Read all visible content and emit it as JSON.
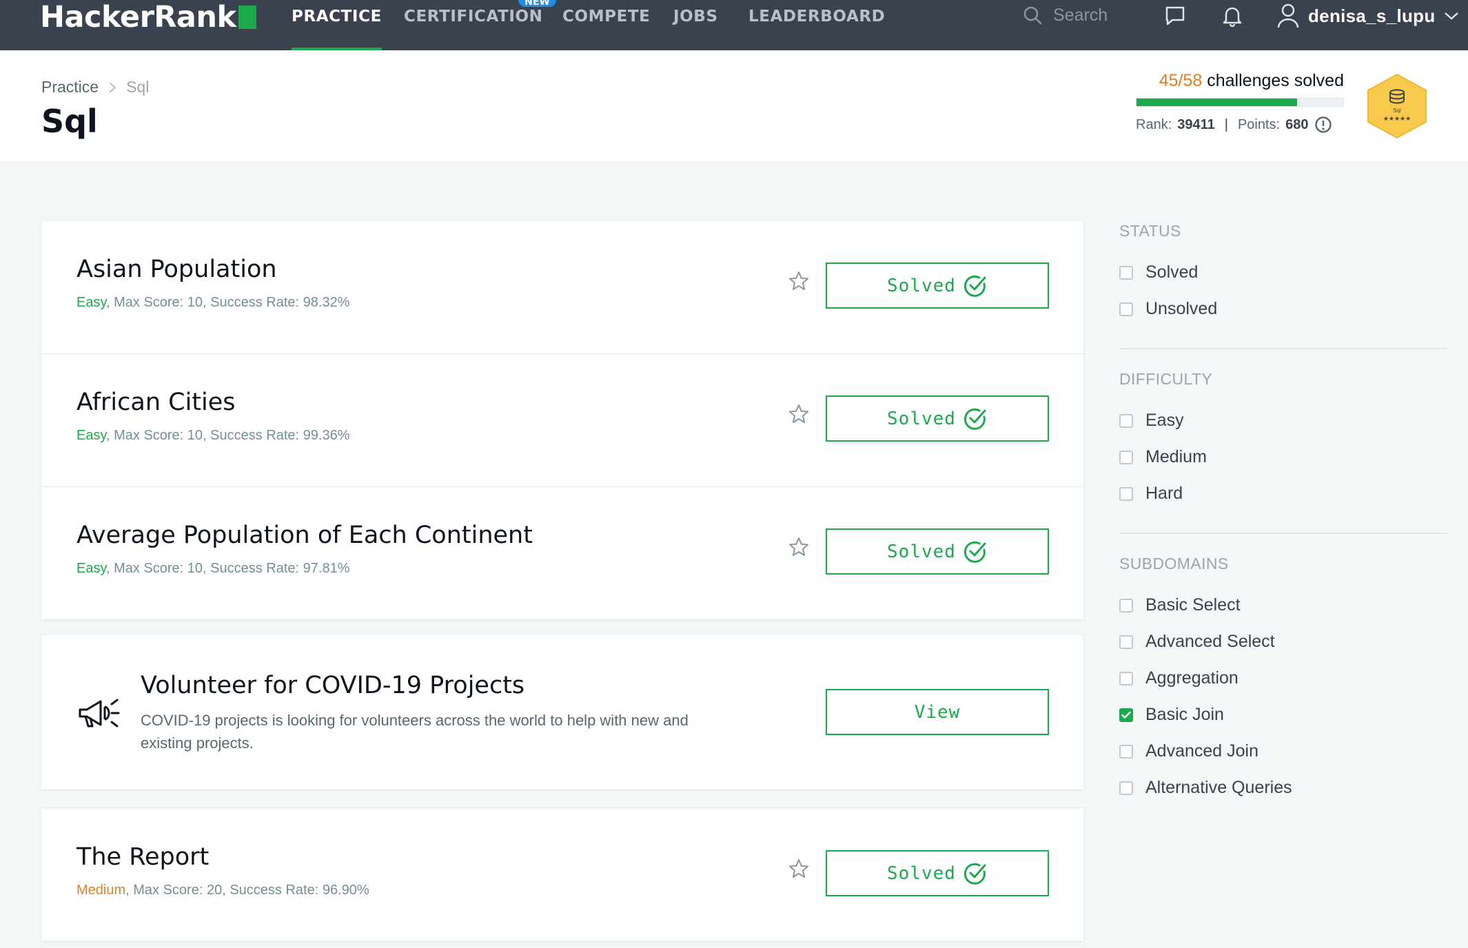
{
  "nav": {
    "logo": "HackerRank",
    "items": [
      {
        "label": "PRACTICE",
        "active": true
      },
      {
        "label": "CERTIFICATION",
        "active": false,
        "badge": "NEW"
      },
      {
        "label": "COMPETE",
        "active": false
      },
      {
        "label": "JOBS",
        "active": false
      },
      {
        "label": "LEADERBOARD",
        "active": false
      }
    ],
    "search_placeholder": "Search",
    "username": "denisa_s_lupu",
    "icons": [
      "search-icon",
      "messages-icon",
      "bell-icon",
      "user-icon",
      "chevron-down-icon"
    ]
  },
  "header": {
    "breadcrumb": [
      "Practice",
      "Sql"
    ],
    "title": "Sql",
    "progress": {
      "solved_count": "45/58",
      "solved_text": "challenges solved",
      "solved_fraction": 0.776,
      "rank_label": "Rank:",
      "rank_value": "39411",
      "points_label": "Points:",
      "points_value": "680"
    },
    "badge": {
      "label": "Sql",
      "stars": "★★★★★",
      "color": "#f8c94a"
    }
  },
  "challenges": [
    {
      "title": "Asian Population",
      "difficulty": "Easy",
      "meta": ", Max Score: 10, Success Rate: 98.32%",
      "button": "Solved"
    },
    {
      "title": "African Cities",
      "difficulty": "Easy",
      "meta": ", Max Score: 10, Success Rate: 99.36%",
      "button": "Solved"
    },
    {
      "title": "Average Population of Each Continent",
      "difficulty": "Easy",
      "meta": ", Max Score: 10, Success Rate: 97.81%",
      "button": "Solved"
    }
  ],
  "promo": {
    "title": "Volunteer for COVID-19 Projects",
    "description": "COVID-19 projects is looking for volunteers across the world to help with new and existing projects.",
    "button": "View"
  },
  "challenges_after": [
    {
      "title": "The Report",
      "difficulty": "Medium",
      "meta": ", Max Score: 20, Success Rate: 96.90%",
      "button": "Solved"
    }
  ],
  "filters": {
    "status": {
      "heading": "STATUS",
      "options": [
        {
          "label": "Solved",
          "checked": false
        },
        {
          "label": "Unsolved",
          "checked": false
        }
      ]
    },
    "difficulty": {
      "heading": "DIFFICULTY",
      "options": [
        {
          "label": "Easy",
          "checked": false
        },
        {
          "label": "Medium",
          "checked": false
        },
        {
          "label": "Hard",
          "checked": false
        }
      ]
    },
    "subdomains": {
      "heading": "SUBDOMAINS",
      "options": [
        {
          "label": "Basic Select",
          "checked": false
        },
        {
          "label": "Advanced Select",
          "checked": false
        },
        {
          "label": "Aggregation",
          "checked": false
        },
        {
          "label": "Basic Join",
          "checked": true
        },
        {
          "label": "Advanced Join",
          "checked": false
        },
        {
          "label": "Alternative Queries",
          "checked": false
        }
      ]
    }
  },
  "colors": {
    "brand_green": "#1ba94c",
    "nav_bg": "#39424e",
    "medium_orange": "#e07e28"
  }
}
